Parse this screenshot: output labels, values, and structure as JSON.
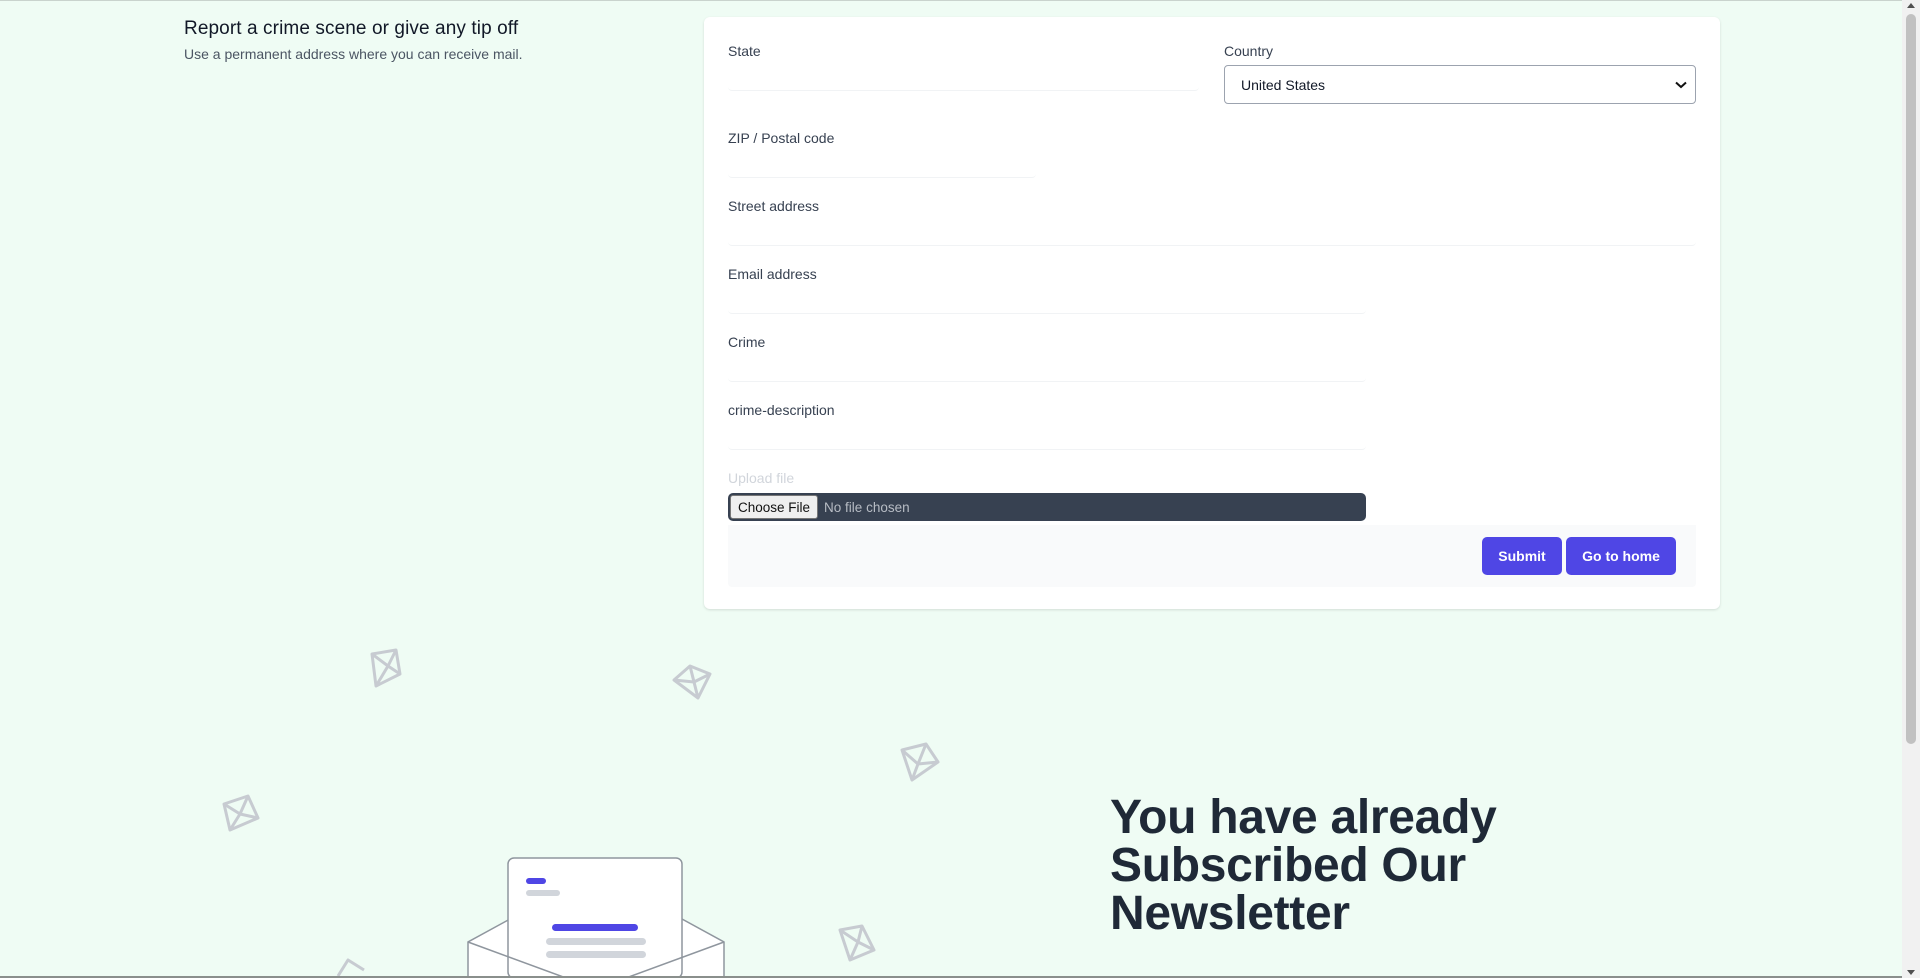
{
  "intro": {
    "title": "Report a crime scene or give any tip off",
    "subtitle": "Use a permanent address where you can receive mail."
  },
  "form": {
    "state_label": "State",
    "state_value": "",
    "country_label": "Country",
    "country_value": "United States",
    "zip_label": "ZIP / Postal code",
    "zip_value": "",
    "street_label": "Street address",
    "street_value": "",
    "email_label": "Email address",
    "email_value": "",
    "crime_label": "Crime",
    "crime_value": "",
    "description_label": "crime-description",
    "description_value": "",
    "upload_label": "Upload file",
    "choose_file_label": "Choose File",
    "file_status": "No file chosen",
    "submit_label": "Submit",
    "home_label": "Go to home"
  },
  "newsletter": {
    "line1": "You have already",
    "line2": "Subscribed Our",
    "line3": "Newsletter"
  },
  "colors": {
    "page_bg": "#effcf4",
    "accent": "#4f46e5",
    "file_input_bg": "#374151"
  },
  "icons": [
    "envelope-illustration-icon",
    "floating-envelope-icon",
    "chevron-down-icon"
  ]
}
